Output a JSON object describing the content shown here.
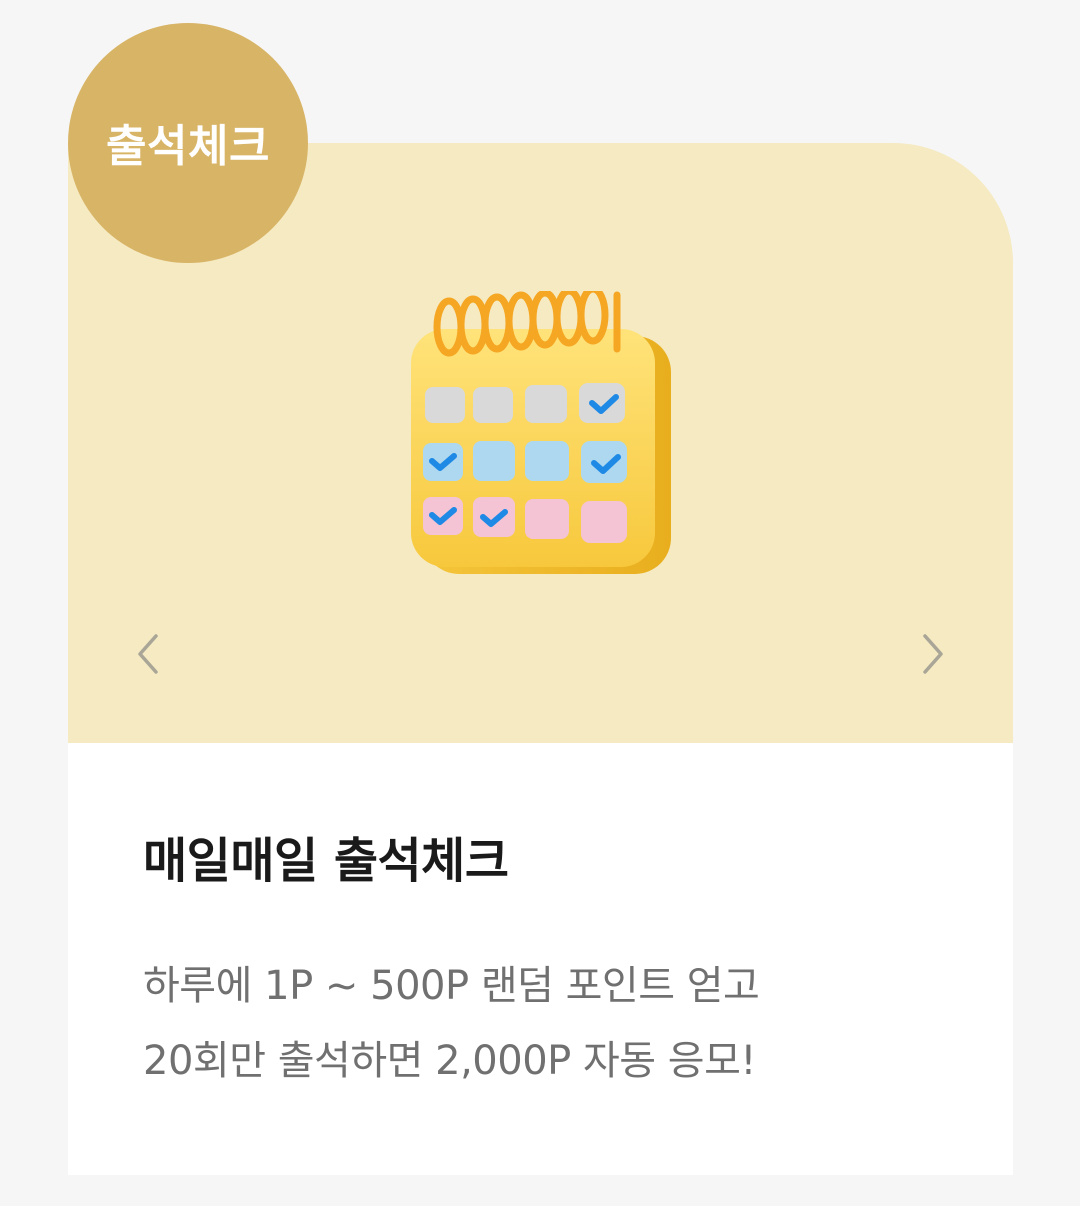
{
  "badge": {
    "label": "출석체크"
  },
  "hero": {
    "image_icon": "calendar-check-icon",
    "prev_icon": "chevron-left-icon",
    "next_icon": "chevron-right-icon"
  },
  "content": {
    "title": "매일매일 출석체크",
    "description_line1": "하루에 1P ~ 500P 랜덤 포인트 얻고",
    "description_line2": "20회만 출석하면 2,000P 자동 응모!"
  },
  "colors": {
    "page_background": "#f6f6f6",
    "hero_background": "#f5eac2",
    "badge_background": "#d8b466",
    "title_text": "#1a1a1a",
    "description_text": "#707070"
  }
}
